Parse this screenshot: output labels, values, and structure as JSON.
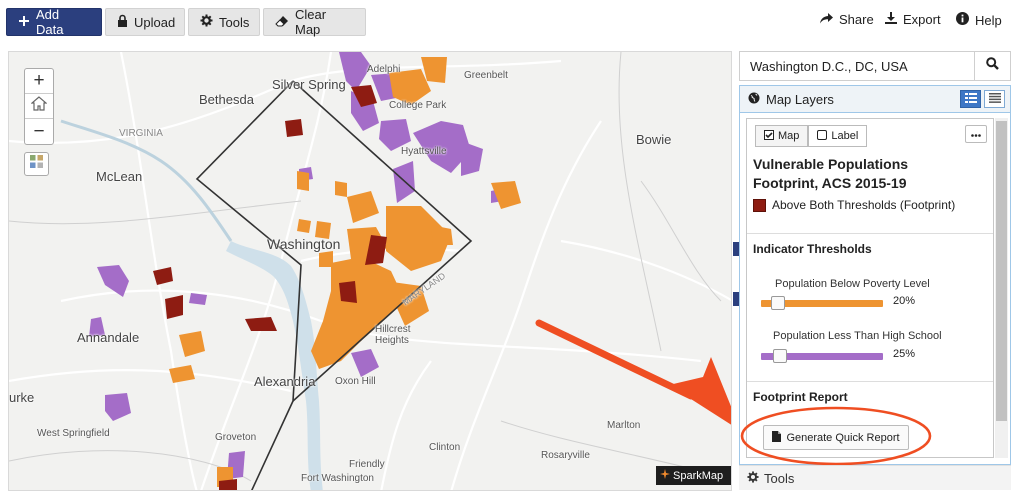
{
  "toolbar": {
    "add_data": "Add Data",
    "upload": "Upload",
    "tools": "Tools",
    "clear_map": "Clear Map",
    "share": "Share",
    "export": "Export",
    "help": "Help"
  },
  "map": {
    "labels": {
      "silver_spring": "Silver Spring",
      "adelphi": "Adelphi",
      "greenbelt": "Greenbelt",
      "college_park": "College Park",
      "bethesda": "Bethesda",
      "hyattsville": "Hyattsville",
      "bowie": "Bowie",
      "virginia": "VIRGINIA",
      "mclean": "McLean",
      "washington": "Washington",
      "maryland": "MARYLAND",
      "annandale": "Annandale",
      "hillcrest_heights": "Hillcrest Heights",
      "alexandria": "Alexandria",
      "oxon_hill": "Oxon Hill",
      "burke": "urke",
      "west_springfield": "West Springfield",
      "groveton": "Groveton",
      "marlton": "Marlton",
      "clinton": "Clinton",
      "rosaryville": "Rosaryville",
      "friendly": "Friendly",
      "fort_washington": "Fort Washington"
    },
    "logo": "SparkMap",
    "colors": {
      "footprint": "#8e1c12",
      "poverty": "#ee9431",
      "education": "#a46dc8",
      "annotation": "#ef4e22"
    }
  },
  "search": {
    "value": "Washington D.C., DC, USA"
  },
  "layers": {
    "title": "Map Layers",
    "map_toggle": "Map",
    "label_toggle": "Label",
    "layer_title_line1": "Vulnerable Populations",
    "layer_title_line2": "Footprint, ACS 2015-19",
    "legend_label": "Above Both Thresholds (Footprint)",
    "thresholds_heading": "Indicator Thresholds",
    "slider1_label": "Population Below Poverty Level",
    "slider1_value": "20%",
    "slider1_level": 0.2,
    "slider2_label": "Population Less Than High School",
    "slider2_value": "25%",
    "slider2_level": 0.25,
    "report_heading": "Footprint Report",
    "report_button": "Generate Quick Report"
  },
  "tools_bar": {
    "label": "Tools"
  }
}
